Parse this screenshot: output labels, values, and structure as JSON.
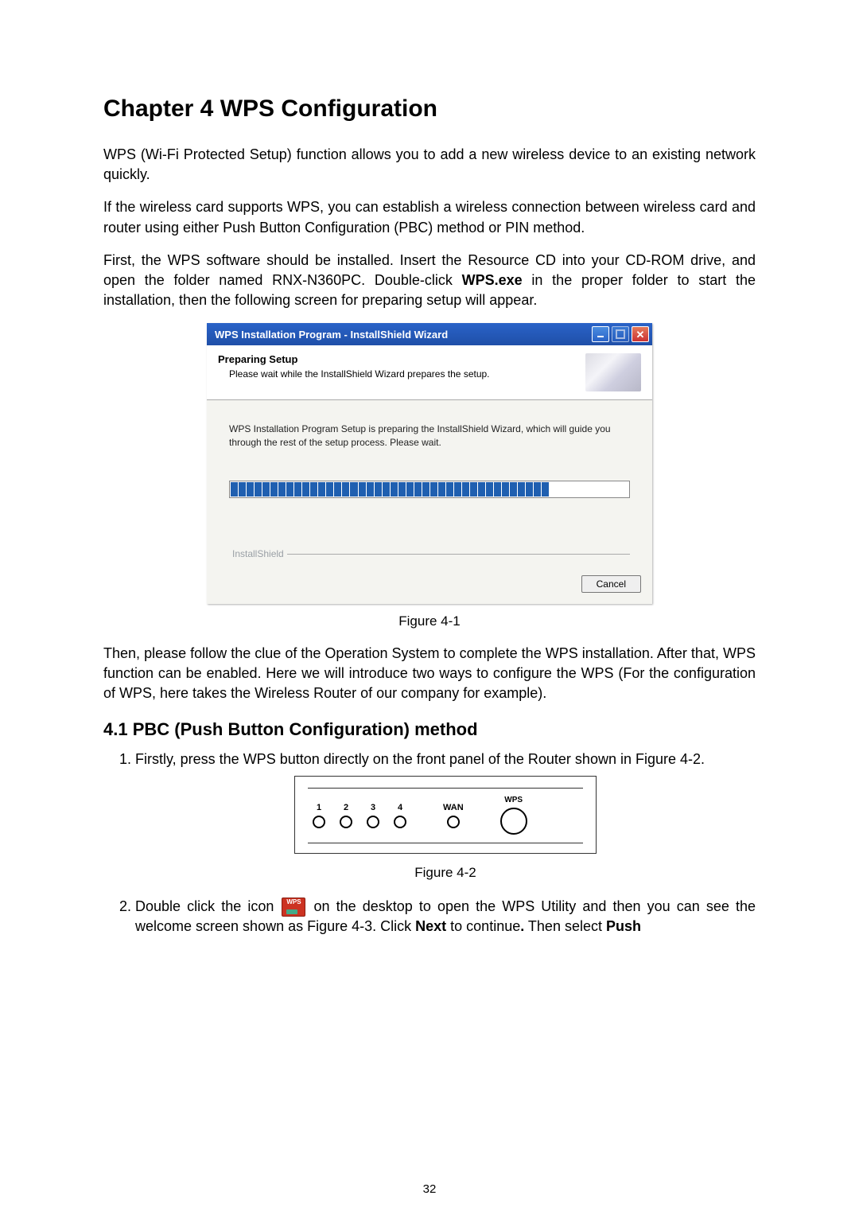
{
  "chapter_title": "Chapter 4  WPS Configuration",
  "para1": "WPS (Wi-Fi Protected Setup) function allows you to add a new wireless device to an existing network quickly.",
  "para2": "If the wireless card supports WPS, you can establish a wireless connection between wireless card and router using either Push Button Configuration (PBC) method or PIN method.",
  "para3_a": "First, the WPS software should be installed. Insert the Resource CD into your CD-ROM drive, and open the folder named RNX-N360PC. Double-click ",
  "para3_bold": "WPS.exe",
  "para3_b": " in the proper folder to start the installation, then the following screen for preparing setup will appear.",
  "wizard": {
    "title": "WPS Installation Program - InstallShield Wizard",
    "heading": "Preparing Setup",
    "subheading": "Please wait while the InstallShield Wizard prepares the setup.",
    "body_msg": "WPS Installation Program Setup is preparing the InstallShield Wizard, which will guide you through the rest of the setup process. Please wait.",
    "footer_label": "InstallShield",
    "cancel": "Cancel",
    "progress_percent": 80
  },
  "fig1_caption": "Figure 4-1",
  "para4": "Then, please follow the clue of the Operation System to complete the WPS installation. After that, WPS function can be enabled. Here we will introduce two ways to configure the WPS (For the configuration of WPS, here takes the Wireless Router of our company for example).",
  "section_title": "4.1   PBC (Push Button Configuration) method",
  "step1": "Firstly, press the WPS button directly on the front panel of the Router shown in Figure 4-2.",
  "router": {
    "leds": [
      "1",
      "2",
      "3",
      "4"
    ],
    "wan_label": "WAN",
    "wps_label": "WPS"
  },
  "fig2_caption": "Figure 4-2",
  "step2_a": "Double click the icon ",
  "step2_b": " on the desktop to open the WPS Utility and then you can see the welcome screen shown as Figure 4-3. Click ",
  "step2_bold1": "Next",
  "step2_c": " to continue",
  "step2_bold_period": ".",
  "step2_d": " Then select ",
  "step2_bold2": "Push",
  "page_number": "32"
}
